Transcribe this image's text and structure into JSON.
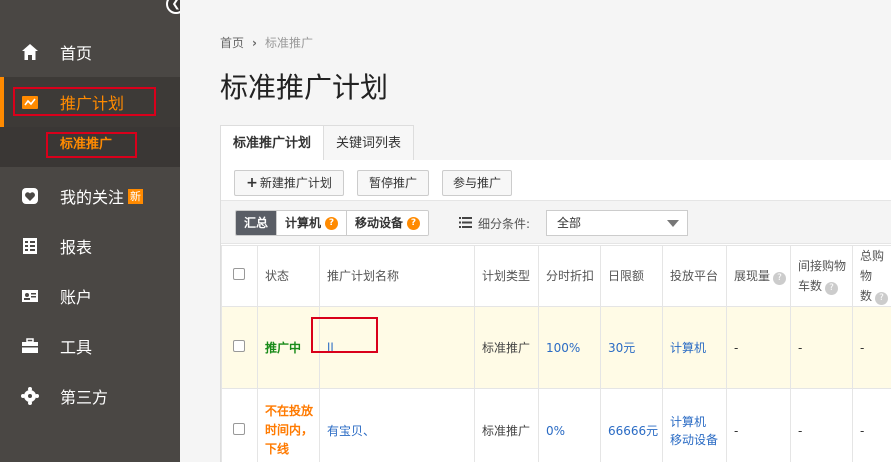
{
  "sidebar": {
    "collapse_icon": "chevron-left-icon",
    "items": [
      {
        "label": "首页",
        "icon": "home-icon"
      },
      {
        "label": "推广计划",
        "icon": "plan-icon"
      },
      {
        "label": "我的关注",
        "icon": "heart-icon",
        "badge": "新"
      },
      {
        "label": "报表",
        "icon": "report-icon"
      },
      {
        "label": "账户",
        "icon": "account-icon"
      },
      {
        "label": "工具",
        "icon": "toolbox-icon"
      },
      {
        "label": "第三方",
        "icon": "third-party-icon"
      }
    ],
    "sub_item": "标准推广",
    "accent": "#ff8a00"
  },
  "breadcrumb": {
    "home": "首页",
    "current": "标准推广"
  },
  "page_title": "标准推广计划",
  "tabs": [
    {
      "label": "标准推广计划"
    },
    {
      "label": "关键词列表"
    }
  ],
  "toolbar": {
    "new_plan": "新建推广计划",
    "pause": "暂停推广",
    "join": "参与推广"
  },
  "filter": {
    "segments": [
      "汇总",
      "计算机",
      "移动设备"
    ],
    "condition_label": "细分条件:",
    "condition_value": "全部"
  },
  "table": {
    "headers": {
      "status": "状态",
      "name": "推广计划名称",
      "type": "计划类型",
      "discount": "分时折扣",
      "daily": "日限额",
      "platform": "投放平台",
      "impressions": "展现量",
      "indirect_line1": "间接购物",
      "indirect_line2": "车数",
      "total_line1": "总购物",
      "total_line2": "数"
    },
    "rows": [
      {
        "status": "推广中",
        "name": "ll",
        "type": "标准推广",
        "discount": "100%",
        "daily": "30元",
        "platform1": "计算机",
        "platform2": "",
        "impressions": "-",
        "indirect": "-",
        "total": "-"
      },
      {
        "status1": "不在投放",
        "status2": "时间内，",
        "status3": "下线",
        "name": "有宝贝、",
        "type": "标准推广",
        "discount": "0%",
        "daily": "66666元",
        "platform1": "计算机",
        "platform2": "移动设备",
        "impressions": "-",
        "indirect": "-",
        "total": "-"
      }
    ]
  }
}
